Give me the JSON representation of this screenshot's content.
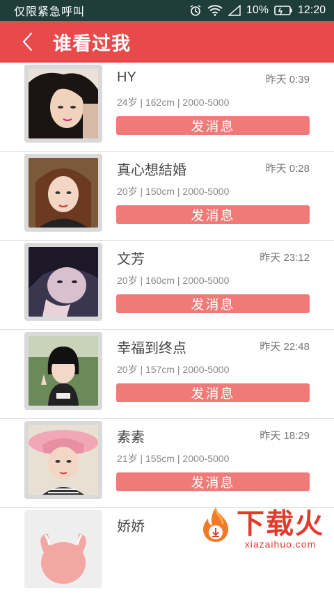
{
  "status_bar": {
    "carrier": "仅限紧急呼叫",
    "battery": "10%",
    "time": "12:20"
  },
  "header": {
    "title": "谁看过我"
  },
  "visitors": [
    {
      "name": "HY",
      "time": "昨天 0:39",
      "meta": "24岁 | 162cm | 2000-5000",
      "button": "发消息"
    },
    {
      "name": "真心想結婚",
      "time": "昨天 0:28",
      "meta": "20岁 | 150cm | 2000-5000",
      "button": "发消息"
    },
    {
      "name": "文芳",
      "time": "昨天 23:12",
      "meta": "20岁 | 160cm | 2000-5000",
      "button": "发消息"
    },
    {
      "name": "幸福到终点",
      "time": "昨天 22:48",
      "meta": "20岁 | 157cm | 2000-5000",
      "button": "发消息"
    },
    {
      "name": "素素",
      "time": "昨天 18:29",
      "meta": "21岁 | 155cm | 2000-5000",
      "button": "发消息"
    },
    {
      "name": "娇娇"
    }
  ],
  "watermark": {
    "main": "下载火",
    "sub": "xiazaihuo.com"
  },
  "colors": {
    "header": "#e84a4c",
    "button": "#f07a78",
    "status_bar": "#1f3d3a"
  }
}
